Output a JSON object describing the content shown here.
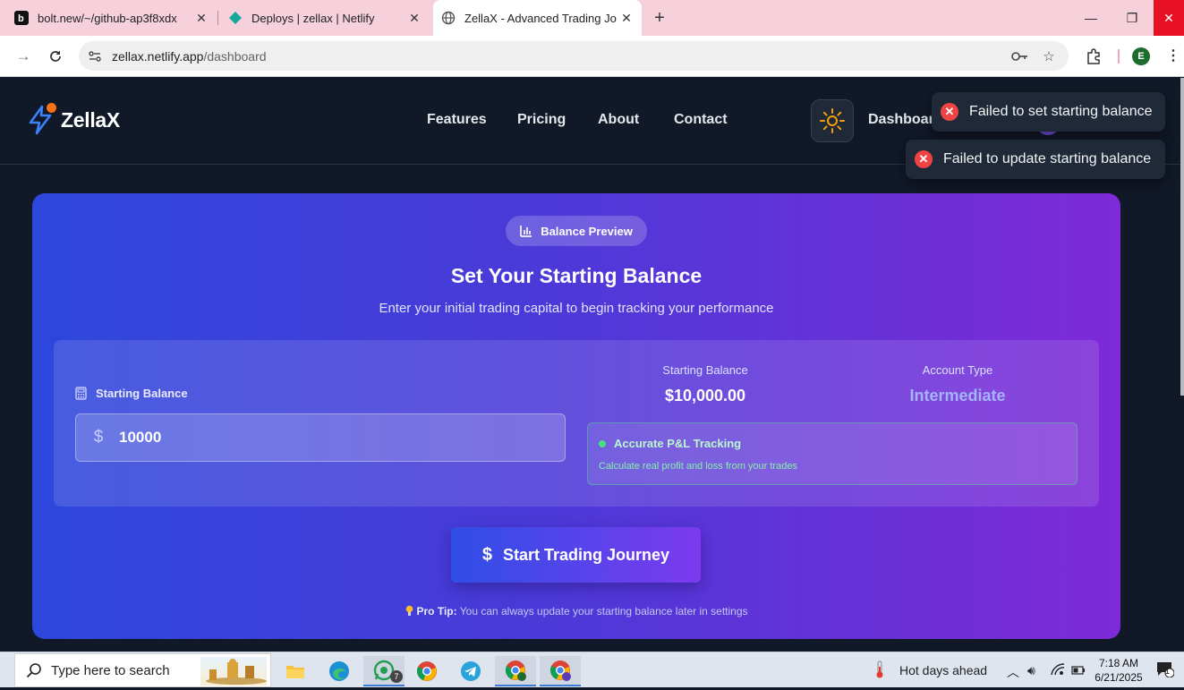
{
  "browser": {
    "tabs": [
      {
        "title": "bolt.new/~/github-ap3f8xdx"
      },
      {
        "title": "Deploys | zellax | Netlify"
      },
      {
        "title": "ZellaX - Advanced Trading Journ"
      }
    ],
    "url_host": "zellax.netlify.app",
    "url_path": "/dashboard",
    "profile_initial": "E"
  },
  "header": {
    "brand": "ZellaX",
    "nav": [
      "Features",
      "Pricing",
      "About",
      "Contact"
    ],
    "dashboard_link": "Dashboard"
  },
  "toasts": [
    {
      "message": "Failed to set starting balance"
    },
    {
      "message": "Failed to update starting balance"
    }
  ],
  "card": {
    "badge": "Balance Preview",
    "title": "Set Your Starting Balance",
    "subtitle": "Enter your initial trading capital to begin tracking your performance",
    "field_label": "Starting Balance",
    "currency_symbol": "$",
    "input_value": "10000",
    "stats": [
      {
        "label": "Starting Balance",
        "value": "$10,000.00",
        "color": "#ffffff"
      },
      {
        "label": "Account Type",
        "value": "Intermediate",
        "color": "#a5b4fc"
      }
    ],
    "feature_title": "Accurate P&L Tracking",
    "feature_desc": "Calculate real profit and loss from your trades",
    "cta": "Start Trading Journey",
    "tip_bold": "Pro Tip:",
    "tip_text": " You can always update your starting balance later in settings"
  },
  "taskbar": {
    "search_placeholder": "Type here to search",
    "whatsapp_badge": "7",
    "weather": "Hot days ahead",
    "time": "7:18 AM",
    "date": "6/21/2025",
    "notifications": "1"
  }
}
